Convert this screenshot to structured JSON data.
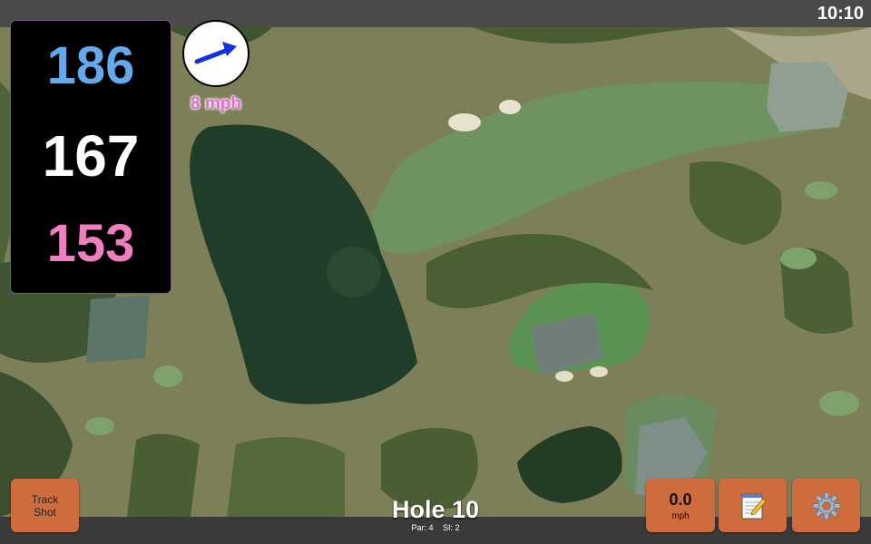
{
  "status_bar": {
    "time": "10:10"
  },
  "yardages": {
    "back": "186",
    "middle": "167",
    "front": "153"
  },
  "wind": {
    "speed_label": "8 mph",
    "arrow_icon": "wind-direction-arrow-icon"
  },
  "hole": {
    "title": "Hole 10",
    "par": "Par: 4",
    "si": "SI: 2"
  },
  "buttons": {
    "track_shot_line1": "Track",
    "track_shot_line2": "Shot",
    "speed_value": "0.0",
    "speed_unit": "mph",
    "notes_icon": "notepad-icon",
    "settings_icon": "gear-icon"
  },
  "colors": {
    "back_yardage": "#63a9ec",
    "middle_yardage": "#ffffff",
    "front_yardage": "#f07ec0",
    "button": "#cf6c3e",
    "wind_label": "#e36bd0"
  }
}
